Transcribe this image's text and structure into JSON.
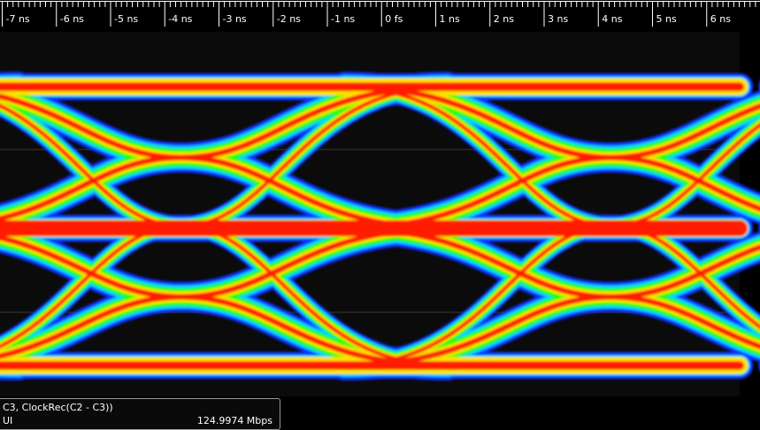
{
  "ruler": {
    "ticks": [
      "-7 ns",
      "-6 ns",
      "-5 ns",
      "-4 ns",
      "-3 ns",
      "-2 ns",
      "-1 ns",
      "0 fs",
      "1 ns",
      "2 ns",
      "3 ns",
      "4 ns",
      "5 ns",
      "6 ns"
    ]
  },
  "info": {
    "source": "C3, ClockRec(C2 - C3))",
    "unit": "UI",
    "bitrate": "124.9974 Mbps"
  },
  "colors": {
    "background": "#000000",
    "plot_bg": "#0b0b0b",
    "heat_cold": "#1030ff",
    "heat_mid": "#1fff10",
    "heat_warm": "#ffe000",
    "heat_hot": "#ff1a00"
  }
}
